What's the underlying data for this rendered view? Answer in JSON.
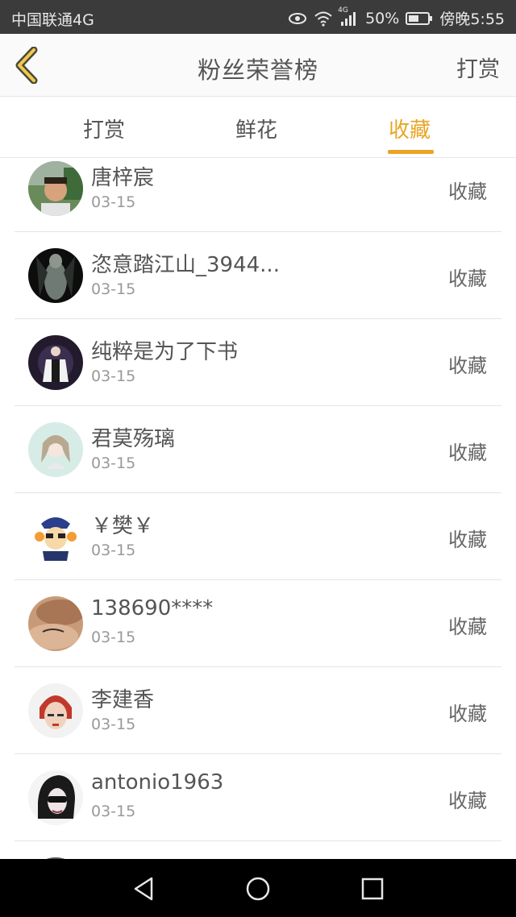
{
  "status_bar": {
    "carrier": "中国联通4G",
    "network_badge": "4G",
    "battery_percent": "50%",
    "time": "傍晚5:55",
    "icons": [
      "eye-icon",
      "wifi-icon",
      "signal-icon",
      "battery-icon"
    ]
  },
  "header": {
    "back_icon": "chevron-left-icon",
    "title": "粉丝荣誉榜",
    "action_label": "打赏"
  },
  "tabs": [
    {
      "label": "打赏",
      "active": false
    },
    {
      "label": "鲜花",
      "active": false
    },
    {
      "label": "收藏",
      "active": true
    }
  ],
  "accent_color": "#e8a525",
  "fans": [
    {
      "name": "唐梓宸",
      "date": "03-15",
      "action": "收藏",
      "avatar": "avatar-child-photo"
    },
    {
      "name": "恣意踏江山_3944...",
      "date": "03-15",
      "action": "收藏",
      "avatar": "avatar-dark-figure"
    },
    {
      "name": "纯粹是为了下书",
      "date": "03-15",
      "action": "收藏",
      "avatar": "avatar-man-white-coat"
    },
    {
      "name": "君莫殇璃",
      "date": "03-15",
      "action": "收藏",
      "avatar": "avatar-anime-girl"
    },
    {
      "name": "￥樊￥",
      "date": "03-15",
      "action": "收藏",
      "avatar": "avatar-cartoon-cat"
    },
    {
      "name": "138690****",
      "date": "03-15",
      "action": "收藏",
      "avatar": "avatar-skin-tattoo"
    },
    {
      "name": "李建香",
      "date": "03-15",
      "action": "收藏",
      "avatar": "avatar-woman-red-hair"
    },
    {
      "name": "antonio1963",
      "date": "03-15",
      "action": "收藏",
      "avatar": "avatar-sunglasses"
    }
  ],
  "nav_bar": {
    "icons": [
      "back-triangle-icon",
      "home-circle-icon",
      "recents-square-icon"
    ]
  }
}
